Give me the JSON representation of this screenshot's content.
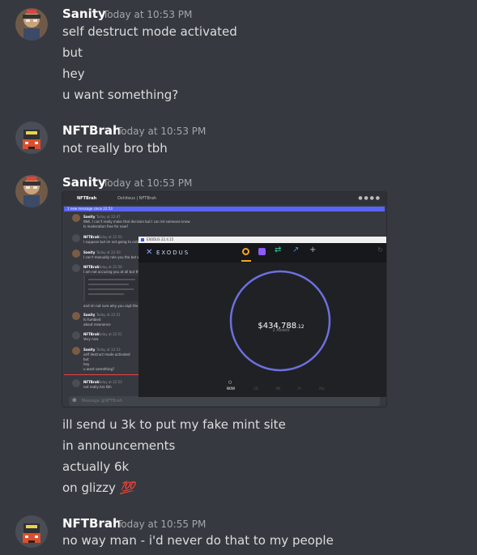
{
  "messages": [
    {
      "username": "Sanity",
      "timestamp": "Today at 10:53 PM",
      "lines": [
        "self destruct mode activated",
        "but",
        "hey",
        "u want something?"
      ]
    },
    {
      "username": "NFTBrah",
      "timestamp": "Today at 10:53 PM",
      "lines": [
        "not really bro tbh"
      ]
    },
    {
      "username": "Sanity",
      "timestamp": "Today at 10:53 PM",
      "lines": [
        "ill send u 3k to put my fake mint site",
        "in announcements",
        "actually 6k",
        "on glizzy"
      ],
      "emoji": "💯"
    },
    {
      "username": "NFTBrah",
      "timestamp": "Today at 10:55 PM",
      "lines": [
        "no way man - i'd never do that to my people"
      ]
    }
  ],
  "embed": {
    "discord_header": {
      "channel": "NFTBrah",
      "tab": "Oshiteus | NFTBrah"
    },
    "new_messages_bar": "1 new message since 22:53",
    "mini_messages": [
      {
        "name": "Sanity",
        "time": "Today at 22:47",
        "lines": [
          "Well, I can't really make that decision but I can let someone know",
          "Is moderation free for now?"
        ]
      },
      {
        "name": "NFTBrah",
        "time": "Today at 22:50",
        "lines": [
          "I suppose but im not going to order"
        ]
      },
      {
        "name": "Sanity",
        "time": "Today at 22:50",
        "lines": [
          "I can't manually role you tha bot w"
        ]
      },
      {
        "name": "NFTBrah",
        "time": "Today at 22:50",
        "lines": [
          "I am not accusing you at all but the"
        ]
      },
      {
        "name": "Sanity",
        "time": "Today at 22:51",
        "lines": [
          "hi fumbled",
          "about resonance"
        ]
      },
      {
        "name": "NFTBrah",
        "time": "Today at 22:51",
        "lines": [
          "Very nice"
        ]
      },
      {
        "name": "Sanity",
        "time": "Today at 22:53",
        "lines": [
          "self destruct mode activated",
          "but",
          "hey",
          "u want something?"
        ]
      },
      {
        "name": "NFTBrah",
        "time": "Today at 22:53",
        "lines": [
          "not really bro tbh"
        ]
      }
    ],
    "mini_status_text": "and im not sure why you capt the fo",
    "message_input_placeholder": "Message @NFTBrah",
    "exodus": {
      "window_title": "EXODUS 22.4.15",
      "brand": "EXODUS",
      "balance": "$434,788",
      "balance_cents": ".12",
      "assets": "2 Assets",
      "nav": [
        "NOW",
        "1D",
        "1M",
        "1Y",
        "ALL"
      ],
      "ring_color": "#6d6fe0"
    }
  }
}
